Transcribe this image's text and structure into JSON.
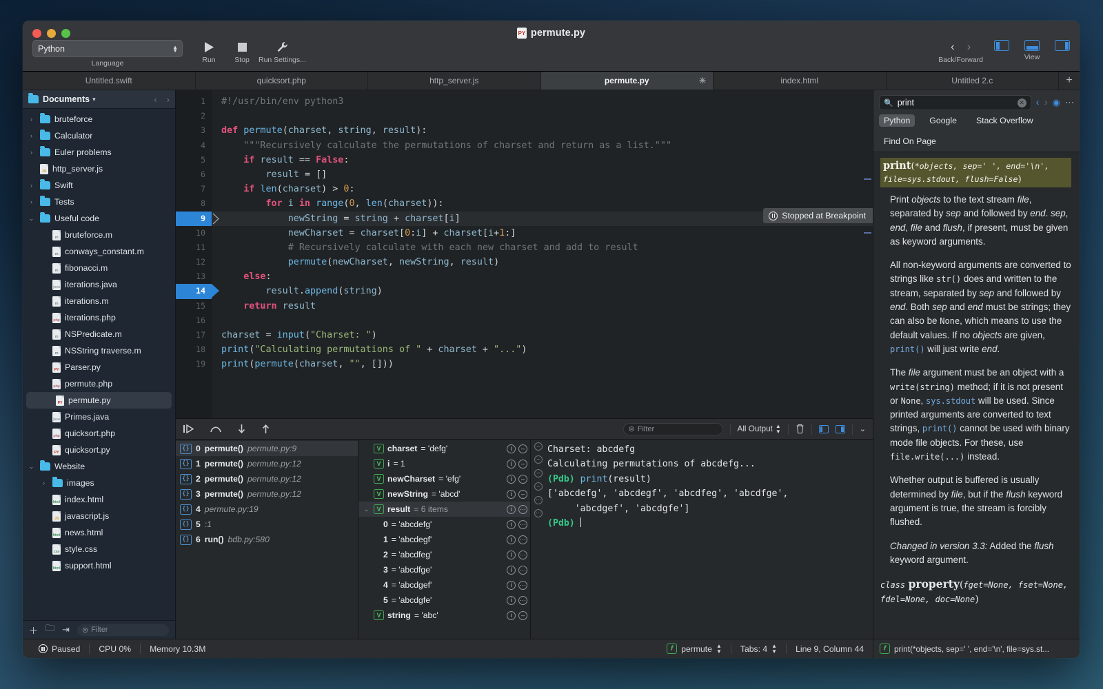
{
  "window": {
    "title": "permute.py"
  },
  "toolbar": {
    "language_value": "Python",
    "language_label": "Language",
    "run_label": "Run",
    "stop_label": "Stop",
    "run_settings_label": "Run Settings...",
    "back_forward_label": "Back/Forward",
    "view_label": "View"
  },
  "tabs": [
    {
      "label": "Untitled.swift",
      "active": false
    },
    {
      "label": "quicksort.php",
      "active": false
    },
    {
      "label": "http_server.js",
      "active": false
    },
    {
      "label": "permute.py",
      "active": true
    },
    {
      "label": "index.html",
      "active": false
    },
    {
      "label": "Untitled 2.c",
      "active": false
    }
  ],
  "tab_add_label": "+",
  "sidebar": {
    "header_title": "Documents",
    "filter_placeholder": "Filter",
    "items": [
      {
        "label": "bruteforce",
        "type": "folder",
        "depth": 0,
        "twisty": "›"
      },
      {
        "label": "Calculator",
        "type": "folder",
        "depth": 0,
        "twisty": "›"
      },
      {
        "label": "Euler problems",
        "type": "folder",
        "depth": 0,
        "twisty": "›"
      },
      {
        "label": "http_server.js",
        "type": "file",
        "ext": "js",
        "depth": 0,
        "twisty": ""
      },
      {
        "label": "Swift",
        "type": "folder",
        "depth": 0,
        "twisty": "›"
      },
      {
        "label": "Tests",
        "type": "folder",
        "depth": 0,
        "twisty": "›"
      },
      {
        "label": "Useful code",
        "type": "folder",
        "depth": 0,
        "twisty": "⌄"
      },
      {
        "label": "bruteforce.m",
        "type": "file",
        "ext": "m",
        "depth": 1,
        "twisty": ""
      },
      {
        "label": "conways_constant.m",
        "type": "file",
        "ext": "m",
        "depth": 1,
        "twisty": ""
      },
      {
        "label": "fibonacci.m",
        "type": "file",
        "ext": "m",
        "depth": 1,
        "twisty": ""
      },
      {
        "label": "iterations.java",
        "type": "file",
        "ext": "java",
        "depth": 1,
        "twisty": ""
      },
      {
        "label": "iterations.m",
        "type": "file",
        "ext": "m",
        "depth": 1,
        "twisty": ""
      },
      {
        "label": "iterations.php",
        "type": "file",
        "ext": "php",
        "depth": 1,
        "twisty": ""
      },
      {
        "label": "NSPredicate.m",
        "type": "file",
        "ext": "m",
        "depth": 1,
        "twisty": ""
      },
      {
        "label": "NSString traverse.m",
        "type": "file",
        "ext": "m",
        "depth": 1,
        "twisty": ""
      },
      {
        "label": "Parser.py",
        "type": "file",
        "ext": "py",
        "depth": 1,
        "twisty": ""
      },
      {
        "label": "permute.php",
        "type": "file",
        "ext": "php",
        "depth": 1,
        "twisty": ""
      },
      {
        "label": "permute.py",
        "type": "file",
        "ext": "py",
        "depth": 1,
        "twisty": "",
        "selected": true
      },
      {
        "label": "Primes.java",
        "type": "file",
        "ext": "java",
        "depth": 1,
        "twisty": ""
      },
      {
        "label": "quicksort.php",
        "type": "file",
        "ext": "php",
        "depth": 1,
        "twisty": ""
      },
      {
        "label": "quicksort.py",
        "type": "file",
        "ext": "py",
        "depth": 1,
        "twisty": ""
      },
      {
        "label": "Website",
        "type": "folder",
        "depth": 0,
        "twisty": "⌄"
      },
      {
        "label": "images",
        "type": "folder",
        "depth": 1,
        "twisty": "›"
      },
      {
        "label": "index.html",
        "type": "file",
        "ext": "html",
        "depth": 1,
        "twisty": ""
      },
      {
        "label": "javascript.js",
        "type": "file",
        "ext": "js",
        "depth": 1,
        "twisty": ""
      },
      {
        "label": "news.html",
        "type": "file",
        "ext": "html",
        "depth": 1,
        "twisty": ""
      },
      {
        "label": "style.css",
        "type": "file",
        "ext": "css",
        "depth": 1,
        "twisty": ""
      },
      {
        "label": "support.html",
        "type": "file",
        "ext": "html",
        "depth": 1,
        "twisty": ""
      }
    ]
  },
  "editor": {
    "current_line": 9,
    "breakpoint_line": 14,
    "stopped_badge": "Stopped at Breakpoint",
    "lines": [
      {
        "n": 1,
        "html": "<span class=\"cmt\">#!/usr/bin/env python3</span>"
      },
      {
        "n": 2,
        "html": ""
      },
      {
        "n": 3,
        "html": "<span class=\"kw\">def</span> <span class=\"fn\">permute</span><span class=\"pl\">(</span><span class=\"id\">charset</span><span class=\"pl\">, </span><span class=\"id\">string</span><span class=\"pl\">, </span><span class=\"id\">result</span><span class=\"pl\">):</span>"
      },
      {
        "n": 4,
        "html": "    <span class=\"cmt\">\"\"\"Recursively calculate the permutations of charset and return as a list.\"\"\"</span>"
      },
      {
        "n": 5,
        "html": "    <span class=\"kw\">if</span> <span class=\"id\">result</span> <span class=\"pl\">==</span> <span class=\"kw\">False</span><span class=\"pl\">:</span>"
      },
      {
        "n": 6,
        "html": "        <span class=\"id\">result</span> <span class=\"pl\">= []</span>"
      },
      {
        "n": 7,
        "html": "    <span class=\"kw\">if</span> <span class=\"fn\">len</span><span class=\"pl\">(</span><span class=\"id\">charset</span><span class=\"pl\">) &gt; </span><span class=\"num\">0</span><span class=\"pl\">:</span>"
      },
      {
        "n": 8,
        "html": "        <span class=\"kw\">for</span> <span class=\"id\">i</span> <span class=\"kw\">in</span> <span class=\"fn\">range</span><span class=\"pl\">(</span><span class=\"num\">0</span><span class=\"pl\">, </span><span class=\"fn\">len</span><span class=\"pl\">(</span><span class=\"id\">charset</span><span class=\"pl\">)):</span>"
      },
      {
        "n": 9,
        "html": "            <span class=\"id\">newString</span> <span class=\"pl\">= </span><span class=\"id\">string</span> <span class=\"pl\">+ </span><span class=\"id\">charset</span><span class=\"pl\">[</span><span class=\"id\">i</span><span class=\"pl\">]</span>"
      },
      {
        "n": 10,
        "html": "            <span class=\"id\">newCharset</span> <span class=\"pl\">= </span><span class=\"id\">charset</span><span class=\"pl\">[</span><span class=\"num\">0</span><span class=\"pl\">:</span><span class=\"id\">i</span><span class=\"pl\">] + </span><span class=\"id\">charset</span><span class=\"pl\">[</span><span class=\"id\">i</span><span class=\"pl\">+</span><span class=\"num\">1</span><span class=\"pl\">:]</span>"
      },
      {
        "n": 11,
        "html": "            <span class=\"cmt\"># Recursively calculate with each new charset and add to result</span>"
      },
      {
        "n": 12,
        "html": "            <span class=\"fn\">permute</span><span class=\"pl\">(</span><span class=\"id\">newCharset</span><span class=\"pl\">, </span><span class=\"id\">newString</span><span class=\"pl\">, </span><span class=\"id\">result</span><span class=\"pl\">)</span>"
      },
      {
        "n": 13,
        "html": "    <span class=\"kw\">else</span><span class=\"pl\">:</span>"
      },
      {
        "n": 14,
        "html": "        <span class=\"id\">result</span><span class=\"pl\">.</span><span class=\"fn\">append</span><span class=\"pl\">(</span><span class=\"id\">string</span><span class=\"pl\">)</span>"
      },
      {
        "n": 15,
        "html": "    <span class=\"kw\">return</span> <span class=\"id\">result</span>"
      },
      {
        "n": 16,
        "html": ""
      },
      {
        "n": 17,
        "html": "<span class=\"id\">charset</span> <span class=\"pl\">= </span><span class=\"fn\">input</span><span class=\"pl\">(</span><span class=\"str\">\"Charset: \"</span><span class=\"pl\">)</span>"
      },
      {
        "n": 18,
        "html": "<span class=\"fn\">print</span><span class=\"pl\">(</span><span class=\"str\">\"Calculating permutations of \"</span> <span class=\"pl\">+ </span><span class=\"id\">charset</span> <span class=\"pl\">+ </span><span class=\"str\">\"...\"</span><span class=\"pl\">)</span>"
      },
      {
        "n": 19,
        "html": "<span class=\"fn\">print</span><span class=\"pl\">(</span><span class=\"fn\">permute</span><span class=\"pl\">(</span><span class=\"id\">charset</span><span class=\"pl\">, </span><span class=\"str\">\"\"</span><span class=\"pl\">, []))</span>"
      }
    ]
  },
  "debugger": {
    "filter_placeholder": "Filter",
    "output_selector": "All Output",
    "stack_frames": [
      {
        "index": "0",
        "name": "permute()",
        "loc": "permute.py:9",
        "selected": true
      },
      {
        "index": "1",
        "name": "permute()",
        "loc": "permute.py:12",
        "selected": false
      },
      {
        "index": "2",
        "name": "permute()",
        "loc": "permute.py:12",
        "selected": false
      },
      {
        "index": "3",
        "name": "permute()",
        "loc": "permute.py:12",
        "selected": false
      },
      {
        "index": "4",
        "name": "",
        "loc": "permute.py:19",
        "selected": false
      },
      {
        "index": "5",
        "name": "",
        "loc": "<string>:1",
        "selected": false
      },
      {
        "index": "6",
        "name": "run()",
        "loc": "bdb.py:580",
        "selected": false
      }
    ],
    "variables": [
      {
        "name": "charset",
        "value": "= 'defg'",
        "badge": "V",
        "child": false,
        "twisty": "",
        "selected": false
      },
      {
        "name": "i",
        "value": "= 1",
        "badge": "V",
        "child": false,
        "twisty": "",
        "selected": false
      },
      {
        "name": "newCharset",
        "value": "= 'efg'",
        "badge": "V",
        "child": false,
        "twisty": "",
        "selected": false
      },
      {
        "name": "newString",
        "value": "= 'abcd'",
        "badge": "V",
        "child": false,
        "twisty": "",
        "selected": false
      },
      {
        "name": "result",
        "value": "= 6 items",
        "badge": "V",
        "child": false,
        "twisty": "⌄",
        "selected": true,
        "dim_value": true
      },
      {
        "name": "0",
        "value": "= 'abcdefg'",
        "badge": "",
        "child": true,
        "twisty": "",
        "selected": false
      },
      {
        "name": "1",
        "value": "= 'abcdegf'",
        "badge": "",
        "child": true,
        "twisty": "",
        "selected": false
      },
      {
        "name": "2",
        "value": "= 'abcdfeg'",
        "badge": "",
        "child": true,
        "twisty": "",
        "selected": false
      },
      {
        "name": "3",
        "value": "= 'abcdfge'",
        "badge": "",
        "child": true,
        "twisty": "",
        "selected": false
      },
      {
        "name": "4",
        "value": "= 'abcdgef'",
        "badge": "",
        "child": true,
        "twisty": "",
        "selected": false
      },
      {
        "name": "5",
        "value": "= 'abcdgfe'",
        "badge": "",
        "child": true,
        "twisty": "",
        "selected": false
      },
      {
        "name": "string",
        "value": "= 'abc'",
        "badge": "V",
        "child": false,
        "twisty": "",
        "selected": false
      }
    ],
    "console_lines": [
      {
        "html": "Charset: abcdefg"
      },
      {
        "html": "Calculating permutations of abcdefg..."
      },
      {
        "html": "<span class=\"pdb\">(Pdb)</span> <span class=\"cfn\">print</span>(result)"
      },
      {
        "html": "['abcdefg', 'abcdegf', 'abcdfeg', 'abcdfge',"
      },
      {
        "html": "     'abcdgef', 'abcdgfe']"
      },
      {
        "html": "<span class=\"pdb\">(Pdb)</span> <span class=\"caret\"></span>"
      }
    ]
  },
  "doc": {
    "search_value": "print",
    "sources": [
      {
        "label": "Python",
        "active": true
      },
      {
        "label": "Google",
        "active": false
      },
      {
        "label": "Stack Overflow",
        "active": false
      },
      {
        "label": "Find On Page",
        "active": false
      }
    ],
    "signature_html": "<b>print</b>(<i>*objects, sep=' ', end='\\n', file=sys.stdout, flush=False</i>)",
    "paragraphs": [
      {
        "html": "Print <i>objects</i> to the text stream <i>file</i>, separated by <i>sep</i> and followed by <i>end</i>. <i>sep</i>, <i>end</i>, <i>file</i> and <i>flush</i>, if present, must be given as keyword arguments.",
        "indent": true
      },
      {
        "html": "All non-keyword arguments are converted to strings like <span class=\"mono\">str()</span> does and written to the stream, separated by <i>sep</i> and followed by <i>end</i>. Both <i>sep</i> and <i>end</i> must be strings; they can also be <span class=\"mono\">None</span>, which means to use the default values. If no <i>objects</i> are given, <span class=\"mono blue\">print()</span> will just write <i>end</i>.",
        "indent": true
      },
      {
        "html": "The <i>file</i> argument must be an object with a <span class=\"mono\">write(string)</span> method; if it is not present or <span class=\"mono\">None</span>, <span class=\"mono blue\">sys.stdout</span> will be used. Since printed arguments are converted to text strings, <span class=\"mono blue\">print()</span> cannot be used with binary mode file objects. For these, use <span class=\"mono\">file.write(...)</span> instead.",
        "indent": true
      },
      {
        "html": "Whether output is buffered is usually determined by <i>file</i>, but if the <i>flush</i> keyword argument is true, the stream is forcibly flushed.",
        "indent": true
      },
      {
        "html": "<i>Changed in version 3.3:</i> Added the <i>flush</i> keyword argument.",
        "indent": true
      }
    ],
    "class_entry_html": "<i>class</i> <b>property</b>(<i>fget=None, fset=None, fdel=None, doc=None</i>)"
  },
  "status": {
    "paused": "Paused",
    "cpu": "CPU 0%",
    "memory": "Memory 10.3M",
    "scope": "permute",
    "tabs": "Tabs: 4",
    "position": "Line 9, Column 44",
    "doc_signature": "print(*objects, sep=' ', end='\\n', file=sys.st..."
  }
}
